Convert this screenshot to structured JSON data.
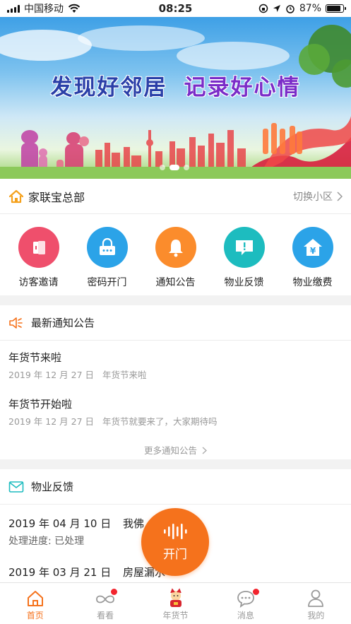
{
  "status_bar": {
    "carrier": "中国移动",
    "time": "08:25",
    "battery": "87%",
    "battery_level": 0.87
  },
  "banner": {
    "title_left": "发现好邻居",
    "title_right": "记录好心情",
    "page_count": 3,
    "active_page": 2
  },
  "community": {
    "name": "家联宝总部",
    "switch_label": "切换小区"
  },
  "quick_actions": [
    {
      "label": "访客邀请",
      "icon": "visitor-invite-icon",
      "color": "#ef4f6c"
    },
    {
      "label": "密码开门",
      "icon": "password-door-icon",
      "color": "#2ba3e8"
    },
    {
      "label": "通知公告",
      "icon": "bell-icon",
      "color": "#fb8c2c"
    },
    {
      "label": "物业反馈",
      "icon": "feedback-icon",
      "color": "#1dbcbf"
    },
    {
      "label": "物业缴费",
      "icon": "payment-icon",
      "color": "#2ba3e8"
    }
  ],
  "notices": {
    "header": "最新通知公告",
    "items": [
      {
        "title": "年货节来啦",
        "date": "2019 年 12 月 27 日",
        "summary": "年货节来啦"
      },
      {
        "title": "年货节开始啦",
        "date": "2019 年 12 月 27 日",
        "summary": "年货节就要来了，大家期待吗"
      }
    ],
    "more_label": "更多通知公告"
  },
  "feedback": {
    "header": "物业反馈",
    "items": [
      {
        "date": "2019 年 04 月 10 日",
        "subject": "我佛",
        "progress": "处理进度: 已处理"
      },
      {
        "date": "2019 年 03 月 21 日",
        "subject": "房屋漏水"
      }
    ]
  },
  "fab": {
    "label": "开门",
    "color": "#f5721c"
  },
  "tabs": [
    {
      "label": "首页",
      "active": true,
      "badge": false
    },
    {
      "label": "看看",
      "active": false,
      "badge": true
    },
    {
      "label": "年货节",
      "active": false,
      "badge": false
    },
    {
      "label": "消息",
      "active": false,
      "badge": true
    },
    {
      "label": "我的",
      "active": false,
      "badge": false
    }
  ],
  "colors": {
    "accent": "#f5721c",
    "badge": "#f2242e"
  }
}
